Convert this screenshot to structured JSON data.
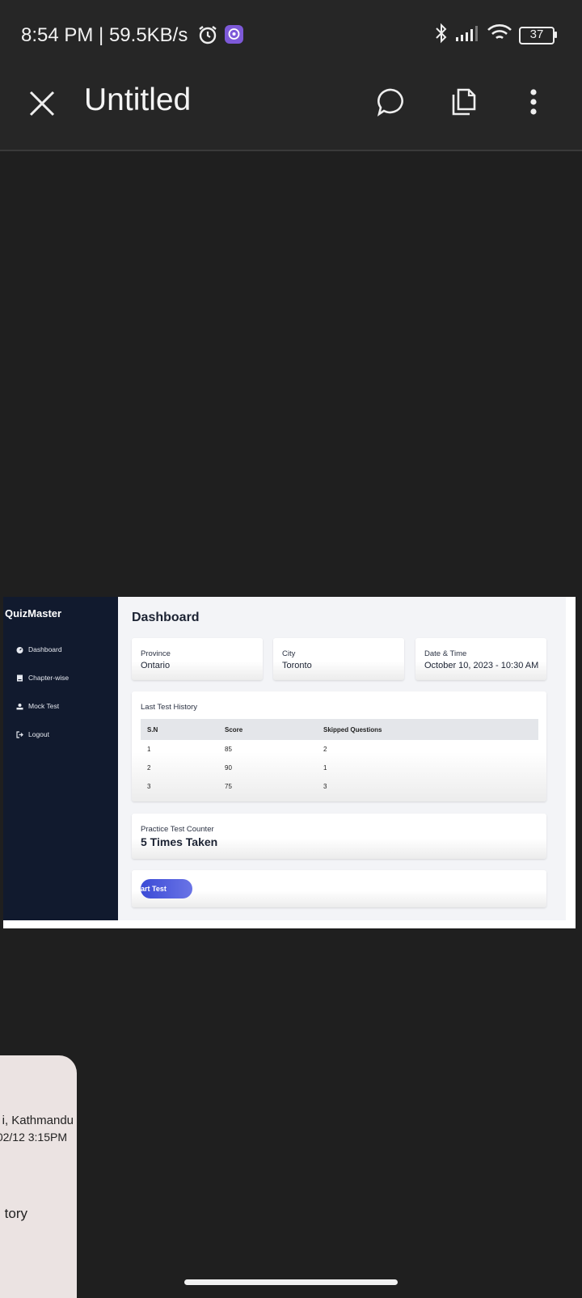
{
  "status_bar": {
    "time_speed": "8:54 PM | 59.5KB/s",
    "battery": "37",
    "icons": [
      "alarm-icon",
      "viber-icon",
      "bluetooth-icon",
      "signal-icon",
      "wifi-icon",
      "battery-icon"
    ]
  },
  "app_bar": {
    "title": "Untitled",
    "icons": [
      "close-icon",
      "comment-icon",
      "copy-icon",
      "more-vert-icon"
    ]
  },
  "embedded": {
    "brand": "QuizMaster",
    "nav": [
      {
        "label": "Dashboard",
        "icon": "dashboard-icon"
      },
      {
        "label": "Chapter-wise",
        "icon": "book-icon"
      },
      {
        "label": "Mock Test",
        "icon": "users-icon"
      },
      {
        "label": "Logout",
        "icon": "logout-icon"
      }
    ],
    "page_title": "Dashboard",
    "info_cards": [
      {
        "label": "Province",
        "value": "Ontario"
      },
      {
        "label": "City",
        "value": "Toronto"
      },
      {
        "label": "Date & Time",
        "value": "October 10, 2023 - 10:30 AM"
      }
    ],
    "history": {
      "title": "Last Test History",
      "headers": [
        "S.N",
        "Score",
        "Skipped Questions"
      ],
      "rows": [
        [
          "1",
          "85",
          "2"
        ],
        [
          "2",
          "90",
          "1"
        ],
        [
          "3",
          "75",
          "3"
        ]
      ]
    },
    "counter": {
      "label": "Practice Test Counter",
      "value": "5 Times Taken"
    },
    "start_button": "art Test"
  },
  "peek_card": {
    "line1": "i, Kathmandu",
    "line2": "02/12  3:15PM",
    "line3": "tory"
  },
  "colors": {
    "background": "#1f1f1f",
    "bar": "#262626",
    "sidebar": "#111a2e",
    "accent": "#4a56dc"
  }
}
